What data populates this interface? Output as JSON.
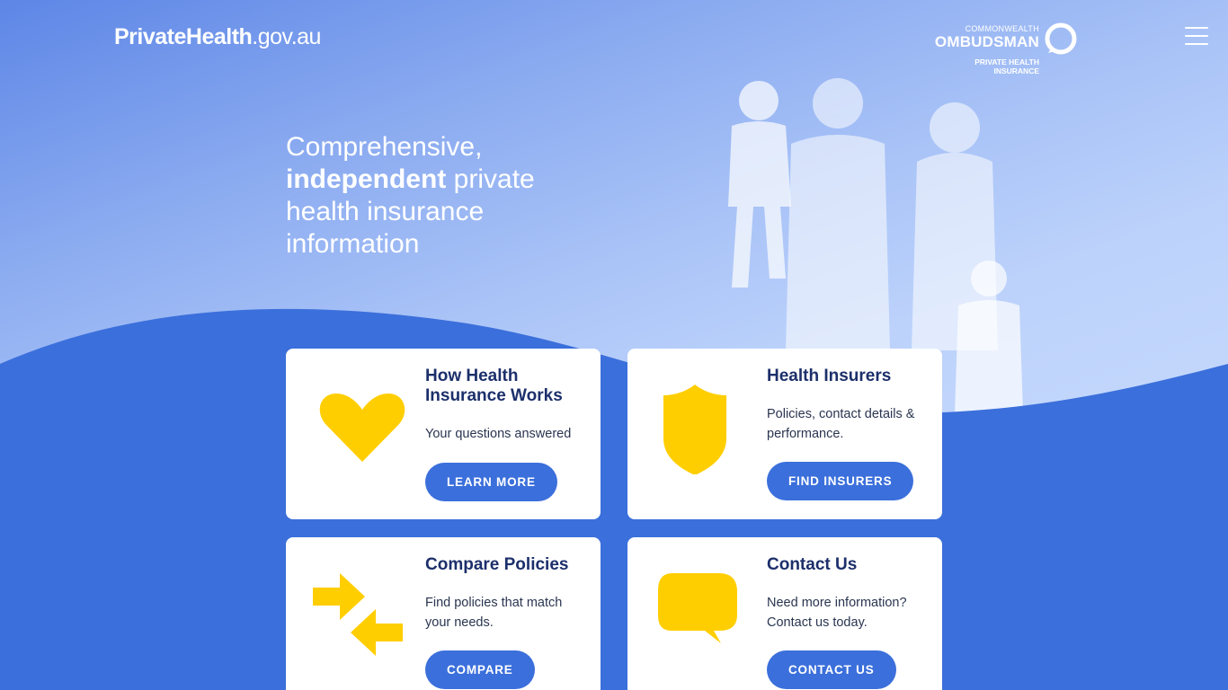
{
  "header": {
    "logo_bold": "PrivateHealth",
    "logo_light": ".gov.au",
    "ombudsman_line1": "COMMONWEALTH",
    "ombudsman_line2": "OMBUDSMAN",
    "ombudsman_line3": "PRIVATE HEALTH",
    "ombudsman_line4": "INSURANCE",
    "menu_icon": "hamburger-menu-icon"
  },
  "hero": {
    "line1": "Comprehensive,",
    "bold": "independent",
    "line2_rest": " private",
    "line3": "health insurance",
    "line4": "information"
  },
  "cards": [
    {
      "title": "How Health Insurance Works",
      "desc": "Your questions answered",
      "button": "LEARN MORE",
      "icon": "heart-icon"
    },
    {
      "title": "Health Insurers",
      "desc": "Policies, contact details & performance.",
      "button": "FIND INSURERS",
      "icon": "shield-icon"
    },
    {
      "title": "Compare Policies",
      "desc": "Find policies that match your needs.",
      "button": "COMPARE",
      "icon": "compare-arrows-icon"
    },
    {
      "title": "Contact Us",
      "desc": "Need more information? Contact us today.",
      "button": "CONTACT US",
      "icon": "speech-bubble-icon"
    }
  ],
  "colors": {
    "background": "#3b6fdb",
    "card": "#ffffff",
    "accent_yellow": "#ffce00",
    "title_text": "#1c2f6b",
    "button": "#3b6fdb"
  }
}
